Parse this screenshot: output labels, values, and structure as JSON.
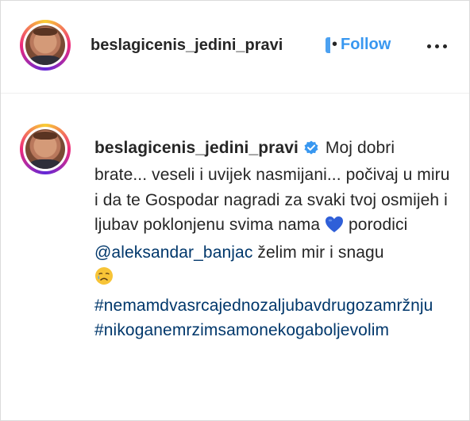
{
  "header": {
    "username": "beslagicenis_jedini_pravi",
    "separator": "•",
    "follow_label": "Follow",
    "more_icon": "more-horizontal-icon"
  },
  "comment": {
    "username": "beslagicenis_jedini_pravi",
    "verified_icon": "verified-badge-icon",
    "text_part1": "Moj dobri brate... veseli i uvijek nasmijani... počivaj u miru i da te Gospodar nagradi za svaki tvoj osmijeh i ljubav poklonjenu svima nama",
    "heart_icon": "blue-heart-icon",
    "text_part2": "porodici",
    "mention": "@aleksandar_banjac",
    "text_part3": "želim mir i snagu",
    "sad_icon": "sad-but-relieved-face-icon",
    "hashtag1": "#nemamdvasrcajednozaljubavdrugozamržnju",
    "hashtag2": "#nikoganemrzimsamonekogaboljevolim"
  },
  "colors": {
    "accent_blue": "#3897f0",
    "link_dark_blue": "#00376b",
    "text": "#262626",
    "heart_blue": "#2f5fd8"
  }
}
